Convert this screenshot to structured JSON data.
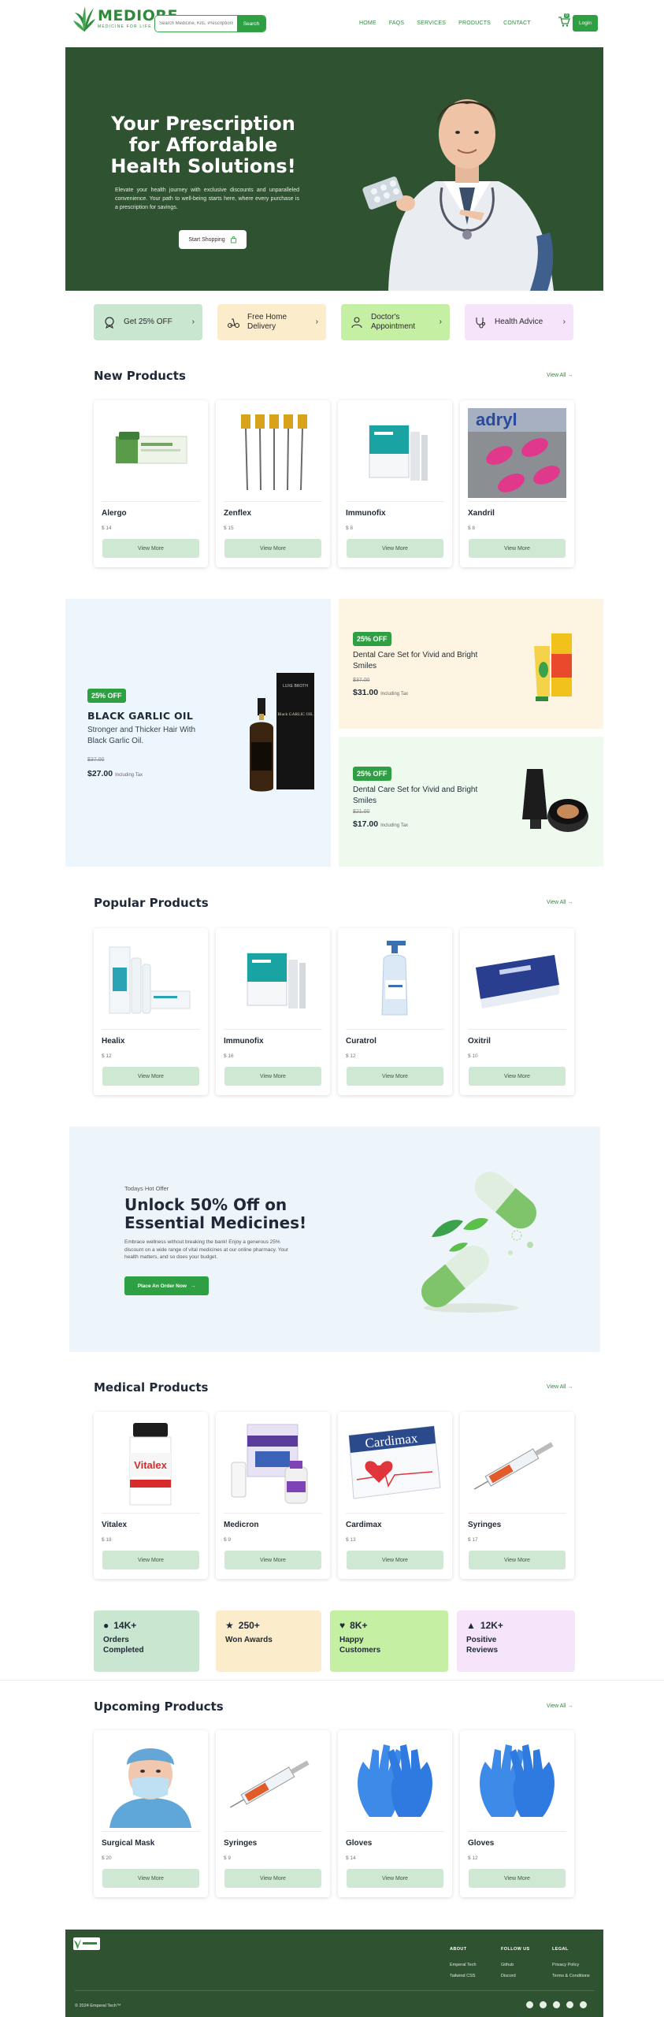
{
  "brand": {
    "name": "MEDIORE",
    "tagline": "MEDICINE FOR LIFE"
  },
  "search": {
    "placeholder": "Search Medicine, Kits, Prescriptions",
    "button": "Search"
  },
  "nav": {
    "items": [
      "HOME",
      "FAQS",
      "SERVICES",
      "PRODUCTS",
      "CONTACT"
    ],
    "cart_count": "0",
    "login": "Login"
  },
  "hero": {
    "title": "Your Prescription for Affordable Health Solutions!",
    "text": "Elevate your health journey with exclusive discounts and unparalleled convenience. Your path to well-being starts here, where every purchase is a prescription for savings.",
    "cta": "Start Shopping"
  },
  "features": [
    {
      "label": "Get 25% OFF",
      "color": "#c8e6d0",
      "icon": "discount-icon"
    },
    {
      "label": "Free Home Delivery",
      "color": "#fbeccb",
      "icon": "scooter-icon"
    },
    {
      "label": "Doctor's Appointment",
      "color": "#c5efa3",
      "icon": "doctor-icon"
    },
    {
      "label": "Health Advice",
      "color": "#f6e5fa",
      "icon": "stethoscope-icon"
    }
  ],
  "view_all": "View All",
  "sections": {
    "new": {
      "title": "New Products",
      "products": [
        {
          "name": "Alergo",
          "price": "$ 14"
        },
        {
          "name": "Zenflex",
          "price": "$ 15"
        },
        {
          "name": "Immunofix",
          "price": "$ 8"
        },
        {
          "name": "Xandril",
          "price": "$ 8"
        }
      ]
    },
    "popular": {
      "title": "Popular Products",
      "products": [
        {
          "name": "Healix",
          "price": "$ 12"
        },
        {
          "name": "Immunofix",
          "price": "$ 16"
        },
        {
          "name": "Curatrol",
          "price": "$ 12"
        },
        {
          "name": "Oxitril",
          "price": "$ 10"
        }
      ]
    },
    "medical": {
      "title": "Medical Products",
      "products": [
        {
          "name": "Vitalex",
          "price": "$ 18"
        },
        {
          "name": "Medicron",
          "price": "$ 9"
        },
        {
          "name": "Cardimax",
          "price": "$ 13"
        },
        {
          "name": "Syringes",
          "price": "$ 17"
        }
      ]
    },
    "upcoming": {
      "title": "Upcoming Products",
      "products": [
        {
          "name": "Surgical Mask",
          "price": "$ 20"
        },
        {
          "name": "Syringes",
          "price": "$ 9"
        },
        {
          "name": "Gloves",
          "price": "$ 14"
        },
        {
          "name": "Gloves",
          "price": "$ 12"
        }
      ]
    }
  },
  "view_more": "View More",
  "promos": {
    "garlic": {
      "badge": "25% OFF",
      "title": "BLACK GARLIC OIL",
      "subtitle": "Stronger and Thicker Hair With Black Garlic Oil.",
      "old_price": "$37.00",
      "price": "$27.00",
      "tax": "Including Tax",
      "bottle_brand": "LUXE BROTH",
      "bottle_text": "Black GARLIC OIL"
    },
    "dental1": {
      "badge": "25% OFF",
      "title": "Dental Care Set for Vivid and Bright Smiles",
      "old_price": "$37.00",
      "price": "$31.00",
      "tax": "Including Tax"
    },
    "dental2": {
      "badge": "25% OFF",
      "title": "Dental Care Set for Vivid and Bright Smiles",
      "old_price": "$21.00",
      "price": "$17.00",
      "tax": "Including Tax"
    }
  },
  "unlock": {
    "eyebrow": "Todays Hot Offer",
    "title": "Unlock 50% Off on Essential Medicines!",
    "text": "Embrace wellness without breaking the bank! Enjoy a generous 25% discount on a wide range of vital medicines at our online pharmacy. Your health matters, and so does your budget.",
    "cta": "Place An Order Now"
  },
  "stats": [
    {
      "value": "14K+",
      "label": "Orders Completed",
      "color": "#c8e6d0"
    },
    {
      "value": "250+",
      "label": "Won Awards",
      "color": "#fbeccb"
    },
    {
      "value": "8K+",
      "label": "Happy Customers",
      "color": "#c5efa3"
    },
    {
      "value": "12K+",
      "label": "Positive Reviews",
      "color": "#f6e5fa"
    }
  ],
  "footer": {
    "about": {
      "heading": "ABOUT",
      "items": [
        "Emperal Tech",
        "Tailwind CSS"
      ]
    },
    "follow": {
      "heading": "FOLLOW US",
      "items": [
        "Github",
        "Discord"
      ]
    },
    "legal": {
      "heading": "LEGAL",
      "items": [
        "Privacy Policy",
        "Terms & Conditions"
      ]
    },
    "copyright": "© 2024 Emperal Tech™"
  },
  "colors": {
    "primary": "#2ea043",
    "dark_green": "#2f5230",
    "soft_button": "#cfe8d4"
  }
}
